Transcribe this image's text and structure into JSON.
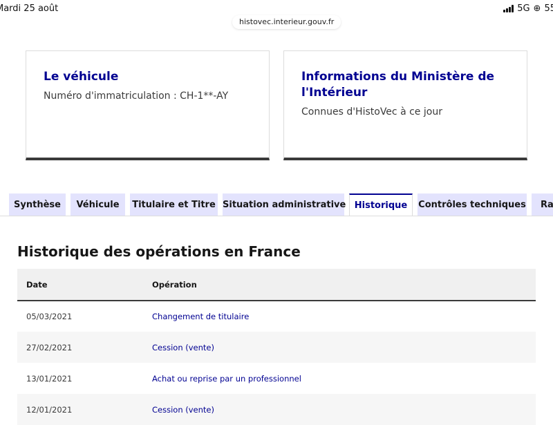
{
  "status_bar": {
    "time": "Mardi 25 août",
    "network": "5G",
    "battery": "55"
  },
  "browser": {
    "url": "histovec.interieur.gouv.fr"
  },
  "cards": [
    {
      "title": "Le véhicule",
      "subtitle": "Numéro d'immatriculation : CH-1**-AY"
    },
    {
      "title": "Informations du Ministère de l'Intérieur",
      "subtitle": "Connues d'HistoVec à ce jour"
    }
  ],
  "tabs": [
    {
      "label": "Synthèse"
    },
    {
      "label": "Véhicule"
    },
    {
      "label": "Titulaire et Titre"
    },
    {
      "label": "Situation administrative"
    },
    {
      "label": "Historique"
    },
    {
      "label": "Contrôles techniques"
    },
    {
      "label": "Rap"
    }
  ],
  "active_tab": "Historique",
  "history": {
    "title": "Historique des opérations en France",
    "columns": {
      "date": "Date",
      "operation": "Opération"
    },
    "rows": [
      {
        "date": "05/03/2021",
        "operation": "Changement de titulaire"
      },
      {
        "date": "27/02/2021",
        "operation": "Cession (vente)"
      },
      {
        "date": "13/01/2021",
        "operation": "Achat ou reprise par un professionnel"
      },
      {
        "date": "12/01/2021",
        "operation": "Cession (vente)"
      }
    ]
  },
  "colors": {
    "accent": "#000091",
    "tab_background": "#e3e3fd",
    "border_dark": "#3a3a3a"
  }
}
